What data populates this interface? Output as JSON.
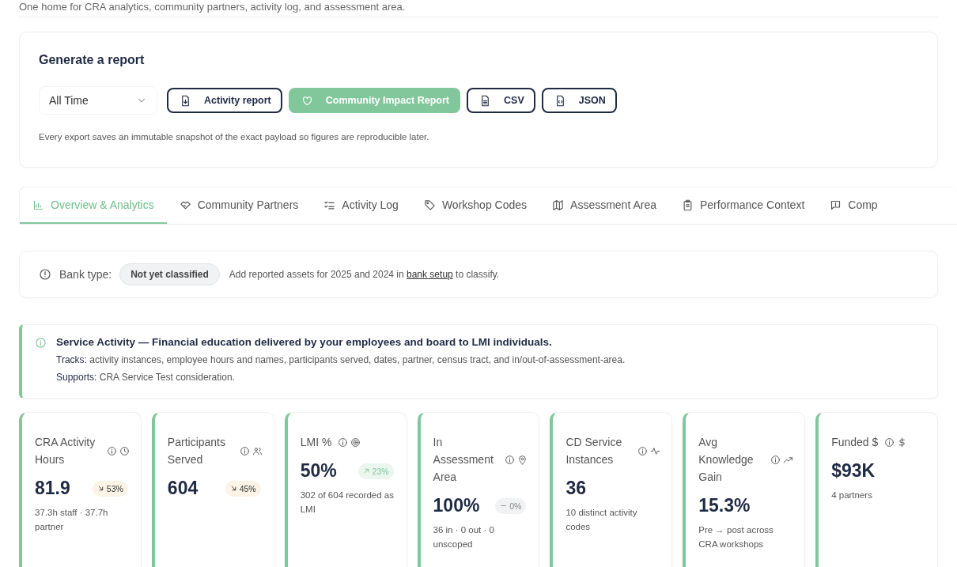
{
  "header": {
    "subtitle": "One home for CRA analytics, community partners, activity log, and assessment area."
  },
  "report": {
    "title": "Generate a report",
    "period": {
      "value": "All Time"
    },
    "buttons": [
      {
        "label": "Activity report",
        "kind": "outline"
      },
      {
        "label": "Community Impact Report",
        "kind": "filled"
      },
      {
        "label": "CSV",
        "kind": "outline"
      },
      {
        "label": "JSON",
        "kind": "outline"
      }
    ],
    "note": "Every export saves an immutable snapshot of the exact payload so figures are reproducible later."
  },
  "tabs": [
    {
      "label": "Overview & Analytics",
      "selected": true
    },
    {
      "label": "Community Partners",
      "selected": false
    },
    {
      "label": "Activity Log",
      "selected": false
    },
    {
      "label": "Workshop Codes",
      "selected": false
    },
    {
      "label": "Assessment Area",
      "selected": false
    },
    {
      "label": "Performance Context",
      "selected": false
    },
    {
      "label": "Comp",
      "selected": false
    }
  ],
  "bank_type": {
    "label": "Bank type:",
    "badge": "Not yet classified",
    "message_before": "Add reported assets for 2025 and 2024 in",
    "link": "bank setup",
    "message_after": "to classify."
  },
  "info": {
    "title": "Service Activity — Financial education delivered by your employees and board to LMI individuals.",
    "lines": [
      "**Tracks:** activity instances, employee hours and names, participants served, dates, partner, census tract, and in/out-of-assessment-area.",
      "**Supports:** CRA Service Test consideration."
    ]
  },
  "metrics": [
    {
      "title": "CRA Activity Hours",
      "value": "81.9",
      "delta": {
        "text": "53%",
        "kind": "down"
      },
      "note": "37.3h staff · 37.7h partner"
    },
    {
      "title": "Participants Served",
      "value": "604",
      "delta": {
        "text": "45%",
        "kind": "down"
      }
    },
    {
      "title": "LMI %",
      "value": "50%",
      "delta": {
        "text": "23%",
        "kind": "up"
      },
      "note": "302 of 604 recorded as LMI"
    },
    {
      "title": "In Assessment Area",
      "value": "100%",
      "delta": {
        "text": "0%",
        "kind": "flat"
      },
      "note": "36 in · 0 out · 0 unscoped"
    },
    {
      "title": "CD Service Instances",
      "value": "36",
      "note": "10 distinct activity codes"
    },
    {
      "title": "Avg Knowledge Gain",
      "value": "15.3%",
      "note": "Pre → post across CRA workshops"
    },
    {
      "title": "Funded $",
      "value": "$93K",
      "note": "4 partners"
    }
  ]
}
